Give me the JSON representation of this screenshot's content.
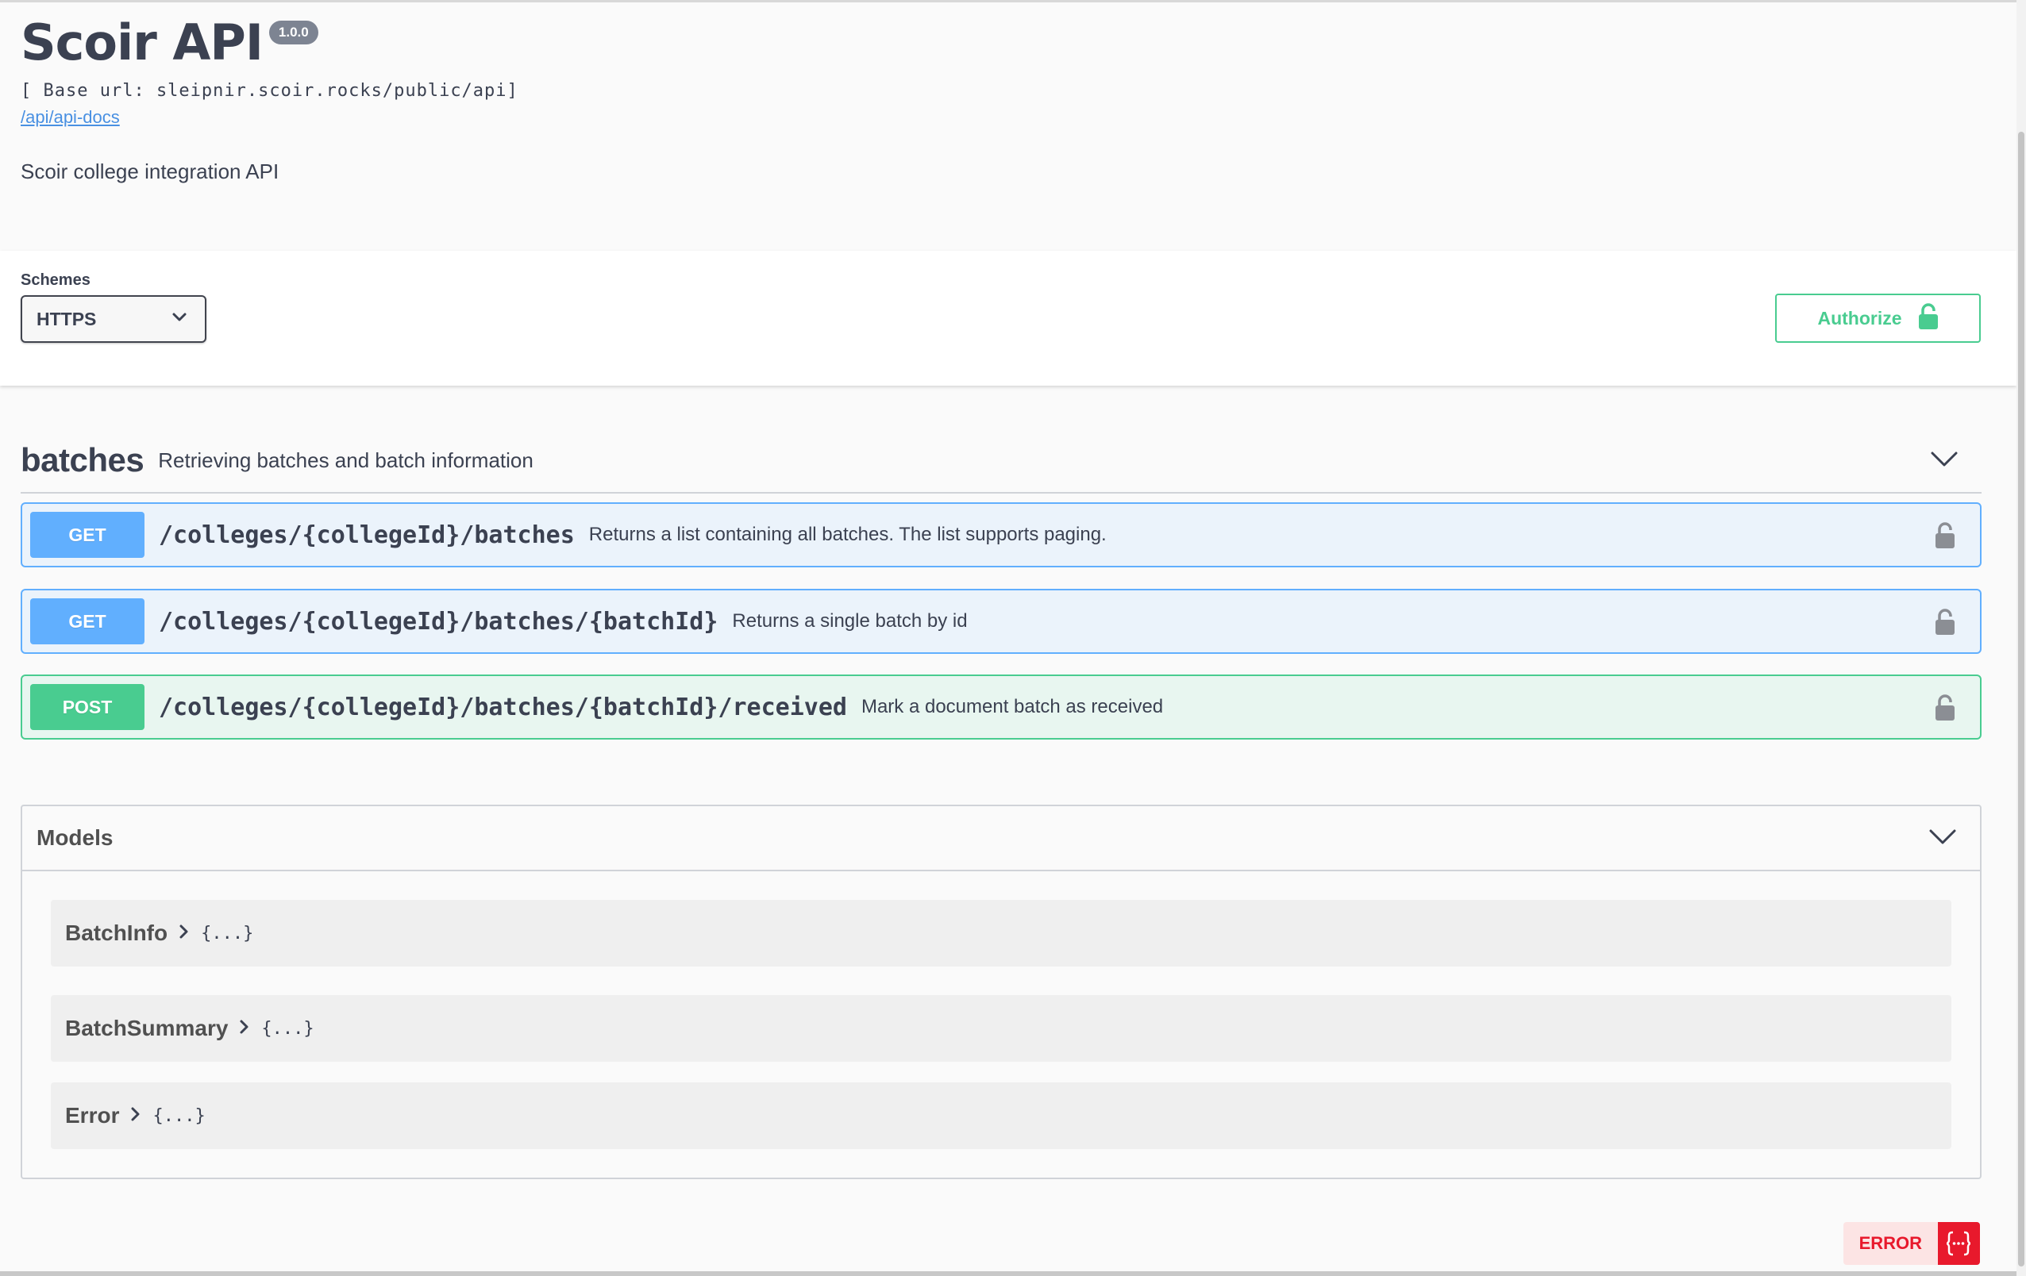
{
  "info": {
    "title": "Scoir API",
    "version": "1.0.0",
    "base_url": "[ Base url: sleipnir.scoir.rocks/public/api]",
    "docs_link": "/api/api-docs",
    "description": "Scoir college integration API"
  },
  "schemes": {
    "label": "Schemes",
    "selected": "HTTPS"
  },
  "authorize": {
    "label": "Authorize"
  },
  "tag": {
    "name": "batches",
    "description": "Retrieving batches and batch information"
  },
  "operations": [
    {
      "method": "GET",
      "path": "/colleges/{collegeId}/batches",
      "summary": "Returns a list containing all batches. The list supports paging."
    },
    {
      "method": "GET",
      "path": "/colleges/{collegeId}/batches/{batchId}",
      "summary": "Returns a single batch by id"
    },
    {
      "method": "POST",
      "path": "/colleges/{collegeId}/batches/{batchId}/received",
      "summary": "Mark a document batch as received"
    }
  ],
  "models": {
    "title": "Models",
    "items": [
      {
        "name": "BatchInfo",
        "brace": "{...}"
      },
      {
        "name": "BatchSummary",
        "brace": "{...}"
      },
      {
        "name": "Error",
        "brace": "{...}"
      }
    ]
  },
  "validator": {
    "label": "ERROR",
    "icon": "{...}"
  },
  "colors": {
    "get": "#61affe",
    "post": "#49cc90",
    "error": "#e8192c",
    "link": "#4990e2"
  }
}
